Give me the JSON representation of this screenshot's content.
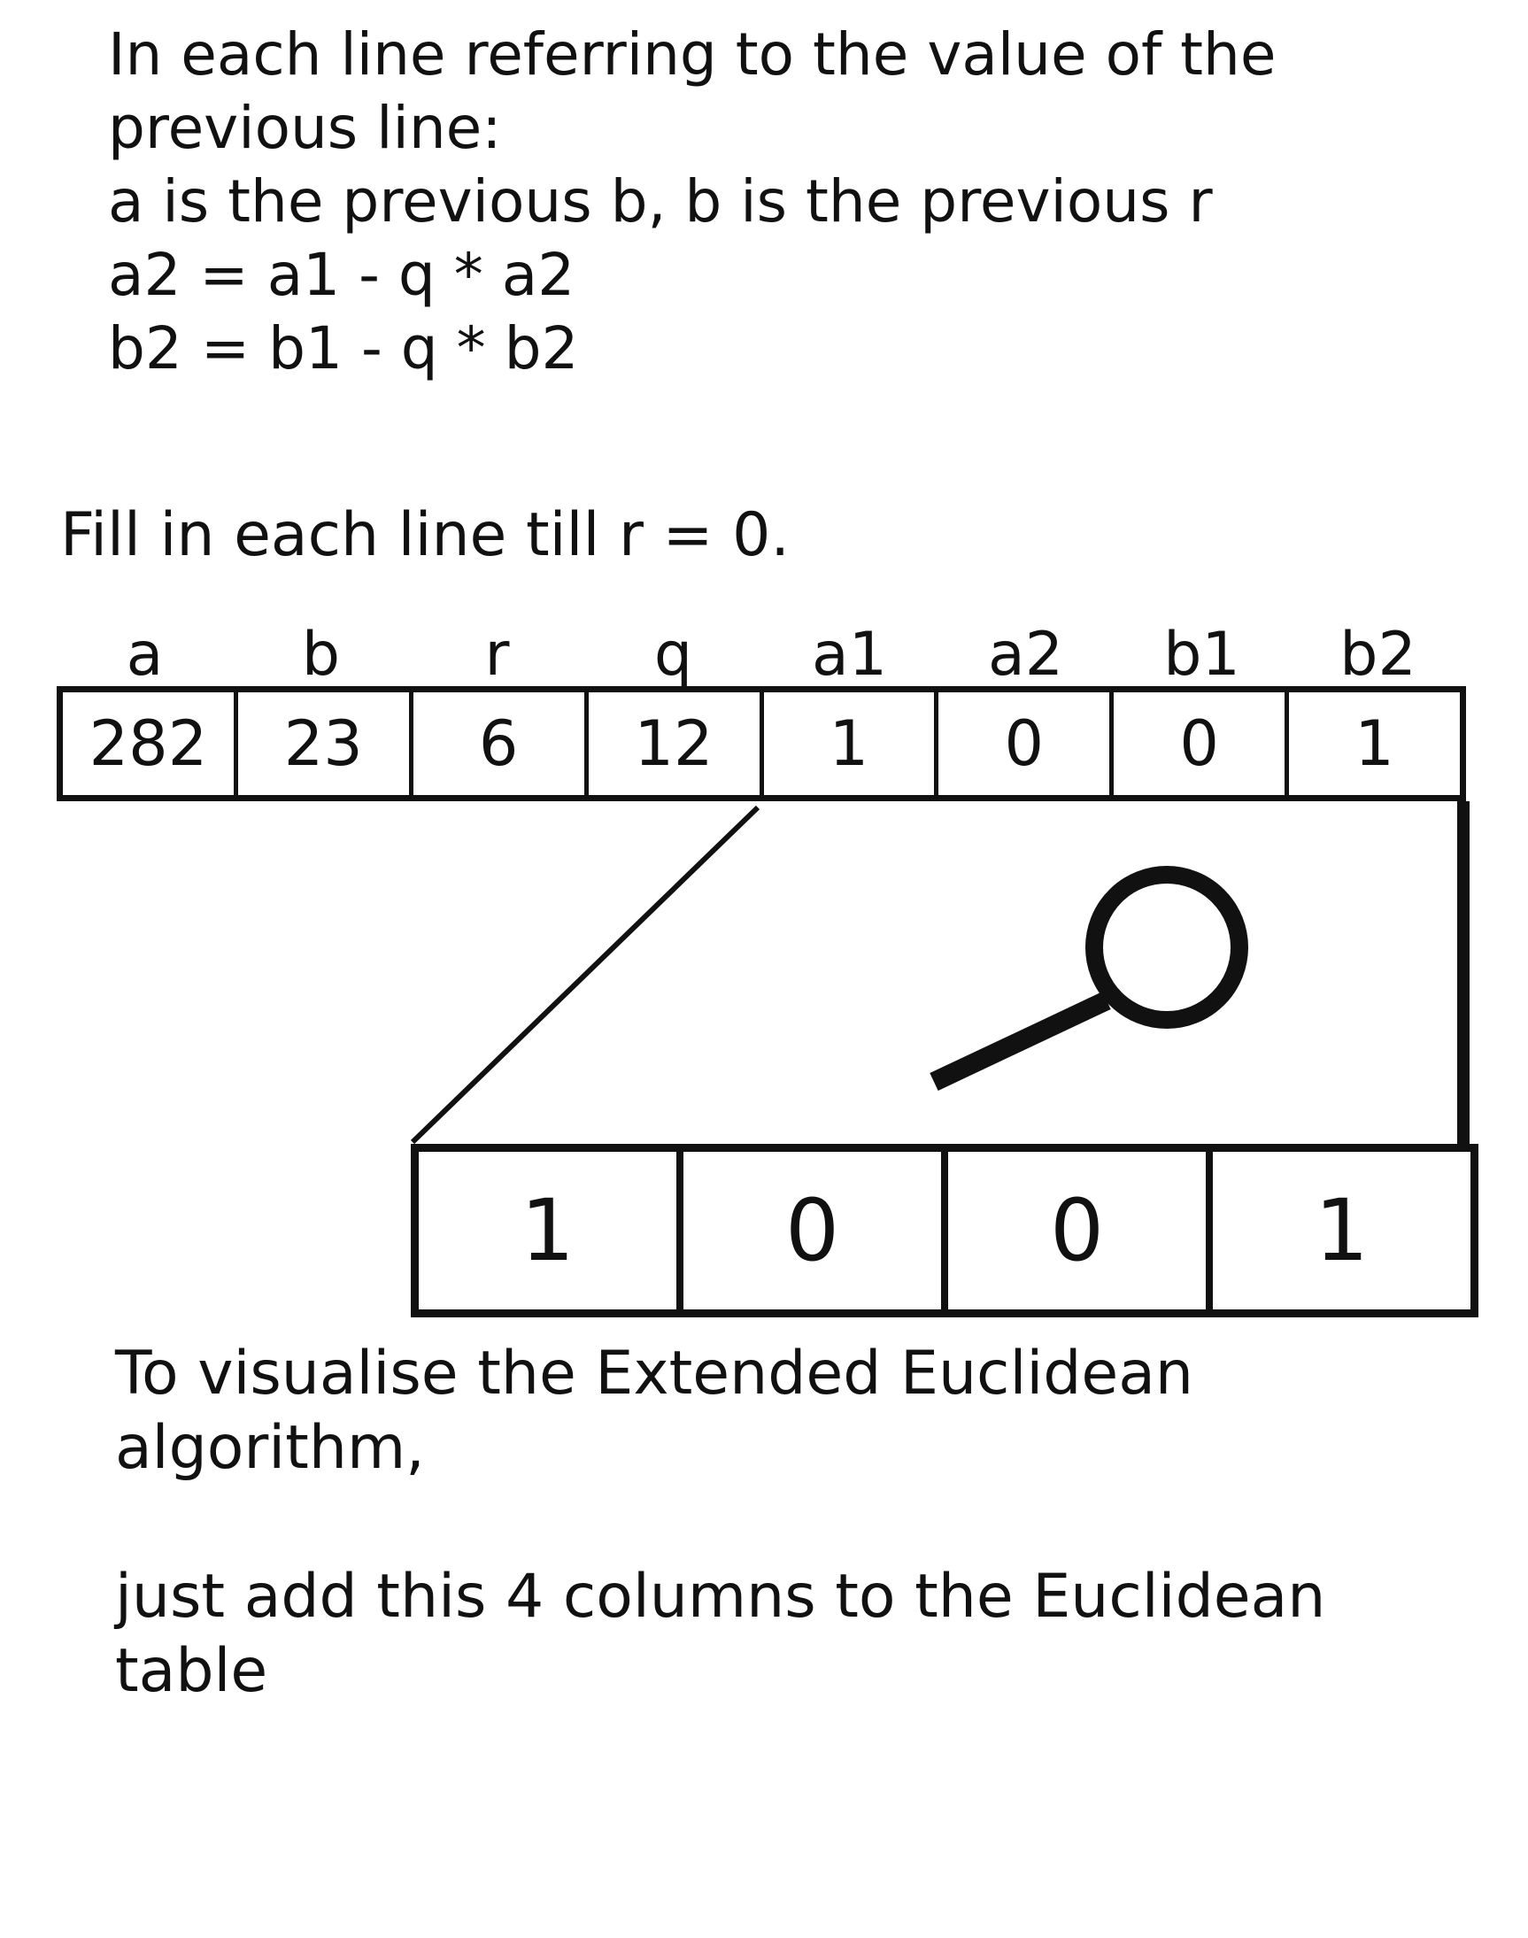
{
  "intro": {
    "line1": "In each line referring to the value of the",
    "line2": "previous line:",
    "line3": "a is the previous b, b is the previous r",
    "line4": "a2 = a1 - q * a2",
    "line5": "b2 = b1 - q * b2"
  },
  "instruction": "Fill in each line till r = 0.",
  "table": {
    "headers": [
      "a",
      "b",
      "r",
      "q",
      "a1",
      "a2",
      "b1",
      "b2"
    ],
    "row": [
      "282",
      "23",
      "6",
      "12",
      "1",
      "0",
      "0",
      "1"
    ]
  },
  "zoom": {
    "icon": "magnifier-icon",
    "cells": [
      "1",
      "0",
      "0",
      "1"
    ]
  },
  "outro": {
    "line1": "To visualise the Extended Euclidean",
    "line2": "algorithm,",
    "line3": "just add this 4 columns to the Euclidean",
    "line4": "table"
  }
}
